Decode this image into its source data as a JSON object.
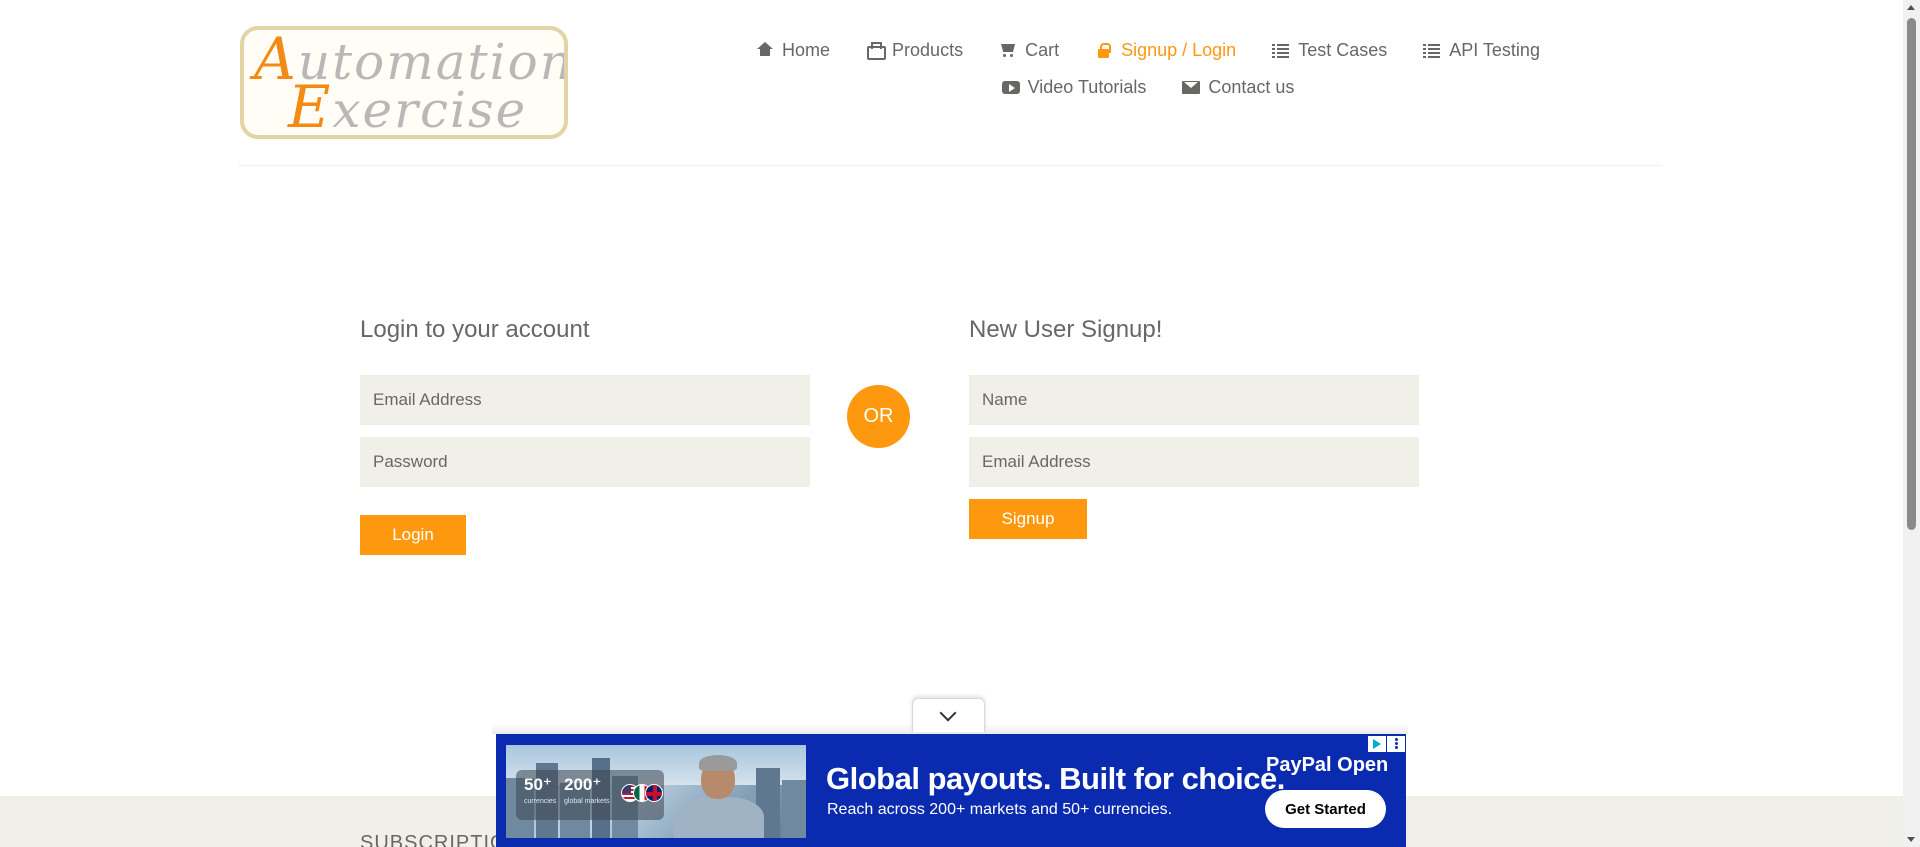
{
  "logo": {
    "line1_cap": "A",
    "line1_rest": "utomation",
    "line2_cap": "E",
    "line2_rest": "xercise"
  },
  "nav": {
    "row1": [
      {
        "label": "Home",
        "icon": "home-icon"
      },
      {
        "label": "Products",
        "icon": "briefcase-icon"
      },
      {
        "label": "Cart",
        "icon": "shopping-cart-icon"
      },
      {
        "label": "Signup / Login",
        "icon": "lock-icon",
        "active": true
      },
      {
        "label": "Test Cases",
        "icon": "list-icon"
      },
      {
        "label": "API Testing",
        "icon": "list-icon"
      }
    ],
    "row2": [
      {
        "label": "Video Tutorials",
        "icon": "youtube-play-icon"
      },
      {
        "label": "Contact us",
        "icon": "envelope-icon"
      }
    ]
  },
  "login": {
    "title": "Login to your account",
    "email_placeholder": "Email Address",
    "password_placeholder": "Password",
    "button": "Login"
  },
  "divider": {
    "or": "OR"
  },
  "signup": {
    "title": "New User Signup!",
    "name_placeholder": "Name",
    "email_placeholder": "Email Address",
    "button": "Signup"
  },
  "footer": {
    "subscription_title": "SUBSCRIPTIO"
  },
  "ad": {
    "stat1_num": "50⁺",
    "stat1_cap": "currencies",
    "stat2_num": "200⁺",
    "stat2_cap": "global markets",
    "headline": "Global payouts. Built for choice.",
    "subline": "Reach across 200+ markets and 50+ currencies.",
    "brand": "PayPal Open",
    "cta": "Get Started"
  },
  "colors": {
    "accent": "#fe980f",
    "text": "#696763",
    "input_bg": "#f0f0e9",
    "ad_bg": "#0a2bb0"
  }
}
